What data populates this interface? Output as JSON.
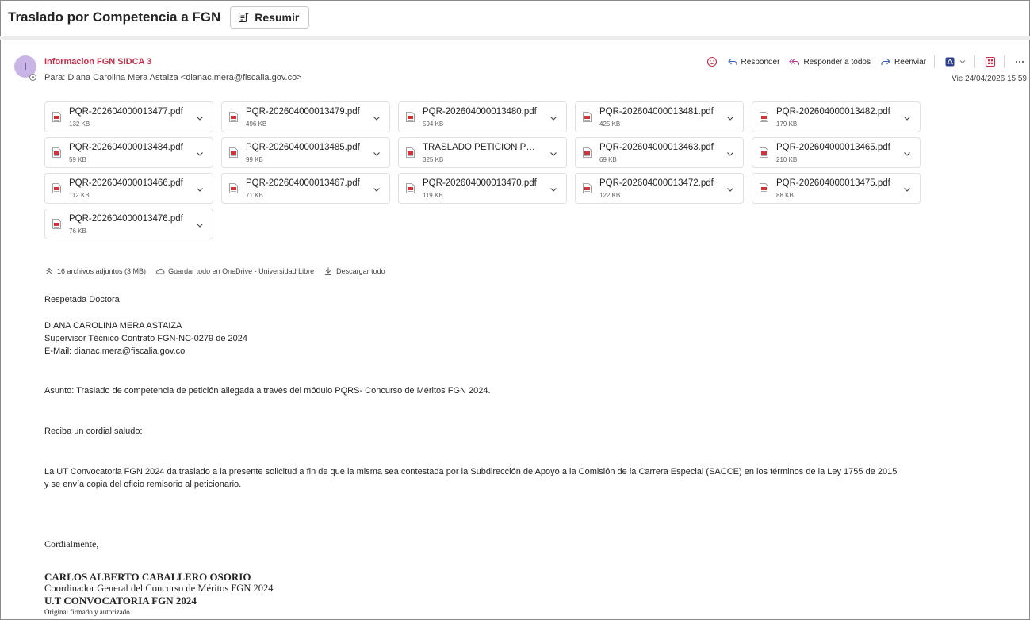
{
  "title_bar": {
    "subject": "Traslado por Competencia a FGN",
    "summarize_label": "Resumir"
  },
  "header": {
    "avatar_initial": "I",
    "sender": "Informacion FGN SIDCA 3",
    "to_line": "Para:  Diana Carolina Mera Astaiza <dianac.mera@fiscalia.gov.co>",
    "date": "Vie 24/04/2026 15:59",
    "actions": {
      "reply": "Responder",
      "reply_all": "Responder a todos",
      "forward": "Reenviar"
    }
  },
  "attachments": [
    {
      "name": "PQR-202604000013477.pdf",
      "size": "132 KB"
    },
    {
      "name": "PQR-202604000013479.pdf",
      "size": "496 KB"
    },
    {
      "name": "PQR-202604000013480.pdf",
      "size": "594 KB"
    },
    {
      "name": "PQR-202604000013481.pdf",
      "size": "425 KB"
    },
    {
      "name": "PQR-202604000013482.pdf",
      "size": "179 KB"
    },
    {
      "name": "PQR-202604000013484.pdf",
      "size": "59 KB"
    },
    {
      "name": "PQR-202604000013485.pdf",
      "size": "99 KB"
    },
    {
      "name": "TRASLADO PETICIÓN POR C...",
      "size": "325 KB"
    },
    {
      "name": "PQR-202604000013463.pdf",
      "size": "69 KB"
    },
    {
      "name": "PQR-202604000013465.pdf",
      "size": "210 KB"
    },
    {
      "name": "PQR-202604000013466.pdf",
      "size": "112 KB"
    },
    {
      "name": "PQR-202604000013467.pdf",
      "size": "71 KB"
    },
    {
      "name": "PQR-202604000013470.pdf",
      "size": "119 KB"
    },
    {
      "name": "PQR-202604000013472.pdf",
      "size": "122 KB"
    },
    {
      "name": "PQR-202604000013475.pdf",
      "size": "88 KB"
    },
    {
      "name": "PQR-202604000013476.pdf",
      "size": "76 KB"
    }
  ],
  "attachment_bar": {
    "count": "16 archivos adjuntos (3 MB)",
    "save_onedrive": "Guardar todo en OneDrive - Universidad Libre",
    "download_all": "Descargar todo"
  },
  "body": {
    "greeting": "Respetada Doctora",
    "recipient_name": "DIANA CAROLINA MERA ASTAIZA",
    "recipient_role": "Supervisor Técnico Contrato FGN-NC-0279 de 2024",
    "recipient_email": "E-Mail: dianac.mera@fiscalia.gov.co",
    "subject_line": "Asunto: Traslado de competencia de petición allegada a través del módulo PQRS- Concurso de Méritos FGN 2024.",
    "salutation": "Reciba un cordial saludo:",
    "paragraph_line1": "La UT Convocatoria FGN 2024 da traslado a la presente solicitud a fin de que la misma sea contestada por la Subdirección de Apoyo a la Comisión de la Carrera Especial (SACCE) en los términos de la Ley 1755 de 2015",
    "paragraph_line2": "y se envía copia del oficio remisorio al peticionario.",
    "closing": "Cordialmente,",
    "signer_name": "CARLOS ALBERTO CABALLERO OSORIO",
    "signer_role": "Coordinador General del Concurso de Méritos FGN 2024",
    "signer_org": "U.T CONVOCATORIA FGN 2024",
    "signer_note": "Original firmado y autorizado."
  }
}
